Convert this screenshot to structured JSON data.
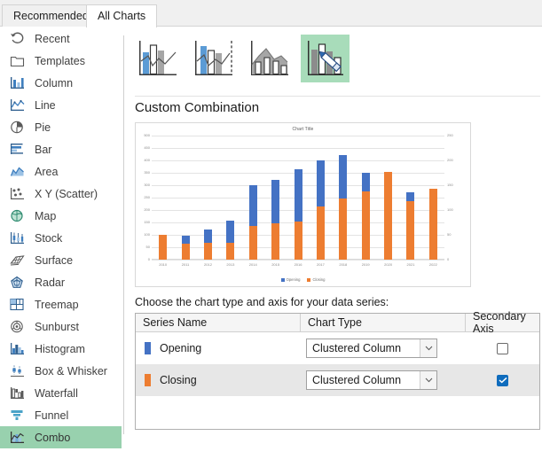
{
  "tabs": [
    {
      "label": "Recommended Charts",
      "active": false
    },
    {
      "label": "All Charts",
      "active": true
    }
  ],
  "sidebar": {
    "items": [
      {
        "label": "Recent",
        "icon": "recent-icon",
        "selected": false
      },
      {
        "label": "Templates",
        "icon": "templates-icon",
        "selected": false
      },
      {
        "label": "Column",
        "icon": "column-icon",
        "selected": false
      },
      {
        "label": "Line",
        "icon": "line-icon",
        "selected": false
      },
      {
        "label": "Pie",
        "icon": "pie-icon",
        "selected": false
      },
      {
        "label": "Bar",
        "icon": "bar-icon",
        "selected": false
      },
      {
        "label": "Area",
        "icon": "area-icon",
        "selected": false
      },
      {
        "label": "X Y (Scatter)",
        "icon": "scatter-icon",
        "selected": false
      },
      {
        "label": "Map",
        "icon": "map-icon",
        "selected": false
      },
      {
        "label": "Stock",
        "icon": "stock-icon",
        "selected": false
      },
      {
        "label": "Surface",
        "icon": "surface-icon",
        "selected": false
      },
      {
        "label": "Radar",
        "icon": "radar-icon",
        "selected": false
      },
      {
        "label": "Treemap",
        "icon": "treemap-icon",
        "selected": false
      },
      {
        "label": "Sunburst",
        "icon": "sunburst-icon",
        "selected": false
      },
      {
        "label": "Histogram",
        "icon": "histogram-icon",
        "selected": false
      },
      {
        "label": "Box & Whisker",
        "icon": "box-whisker-icon",
        "selected": false
      },
      {
        "label": "Waterfall",
        "icon": "waterfall-icon",
        "selected": false
      },
      {
        "label": "Funnel",
        "icon": "funnel-icon",
        "selected": false
      },
      {
        "label": "Combo",
        "icon": "combo-icon",
        "selected": true
      }
    ]
  },
  "thumbnails": [
    {
      "name": "clustered-column-line",
      "selected": false
    },
    {
      "name": "clustered-column-line-on-secondary-axis",
      "selected": false
    },
    {
      "name": "stacked-area-clustered-column",
      "selected": false
    },
    {
      "name": "custom-combination",
      "selected": true
    }
  ],
  "main": {
    "section_title": "Custom Combination",
    "choose_label": "Choose the chart type and axis for your data series:"
  },
  "chart_data": {
    "type": "bar",
    "title": "Chart Title",
    "xlabel": "",
    "ylabel": "",
    "categories": [
      "2010",
      "2011",
      "2012",
      "2013",
      "2014",
      "2015",
      "2016",
      "2017",
      "2018",
      "2019",
      "2020",
      "2021",
      "2022"
    ],
    "series": [
      {
        "name": "Closing",
        "color": "#ed7d31",
        "axis": "secondary",
        "values": [
          100,
          65,
          67,
          68,
          135,
          145,
          155,
          215,
          245,
          275,
          355,
          235,
          285
        ]
      },
      {
        "name": "Opening",
        "color": "#4472c4",
        "axis": "primary",
        "values": [
          0,
          30,
          53,
          90,
          165,
          175,
          210,
          185,
          175,
          75,
          0,
          35,
          0
        ]
      }
    ],
    "ylim": [
      0,
      500
    ],
    "yticks": [
      "0",
      "50",
      "100",
      "150",
      "200",
      "250",
      "300",
      "350",
      "400",
      "450",
      "500"
    ],
    "y2lim": [
      0,
      250
    ],
    "y2ticks": [
      "0",
      "50",
      "100",
      "150",
      "200",
      "250"
    ],
    "grid": true,
    "legend_position": "bottom",
    "legend": [
      "Opening",
      "Closing"
    ]
  },
  "series_table": {
    "columns": [
      "Series Name",
      "Chart Type",
      "Secondary Axis"
    ],
    "rows": [
      {
        "series_name": "Opening",
        "swatch_color": "#4472c4",
        "chart_type": "Clustered Column",
        "secondary_axis": false
      },
      {
        "series_name": "Closing",
        "swatch_color": "#ed7d31",
        "chart_type": "Clustered Column",
        "secondary_axis": true
      }
    ]
  }
}
